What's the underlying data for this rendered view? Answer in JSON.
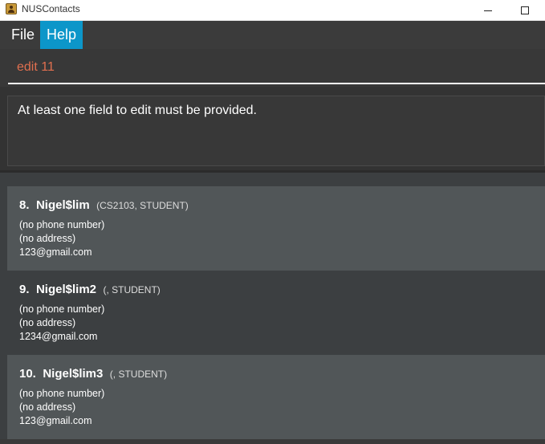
{
  "window": {
    "title": "NUSContacts",
    "icon": "app-contacts-icon"
  },
  "menu": {
    "file_label": "File",
    "help_label": "Help",
    "active": "Help",
    "accent_color": "#0c96c9"
  },
  "command_box": {
    "value": "edit 11",
    "text_color": "#e06f4f"
  },
  "result_display": {
    "message": "At least one field to edit must be provided."
  },
  "persons": [
    {
      "index": "8.",
      "name": "Nigel$lim",
      "tags": "(CS2103,  STUDENT)",
      "phone": "(no phone number)",
      "address": "(no address)",
      "email": "123@gmail.com"
    },
    {
      "index": "9.",
      "name": "Nigel$lim2",
      "tags": "(,  STUDENT)",
      "phone": "(no phone number)",
      "address": "(no address)",
      "email": "1234@gmail.com"
    },
    {
      "index": "10.",
      "name": "Nigel$lim3",
      "tags": "(,  STUDENT)",
      "phone": "(no phone number)",
      "address": "(no address)",
      "email": "123@gmail.com"
    }
  ]
}
